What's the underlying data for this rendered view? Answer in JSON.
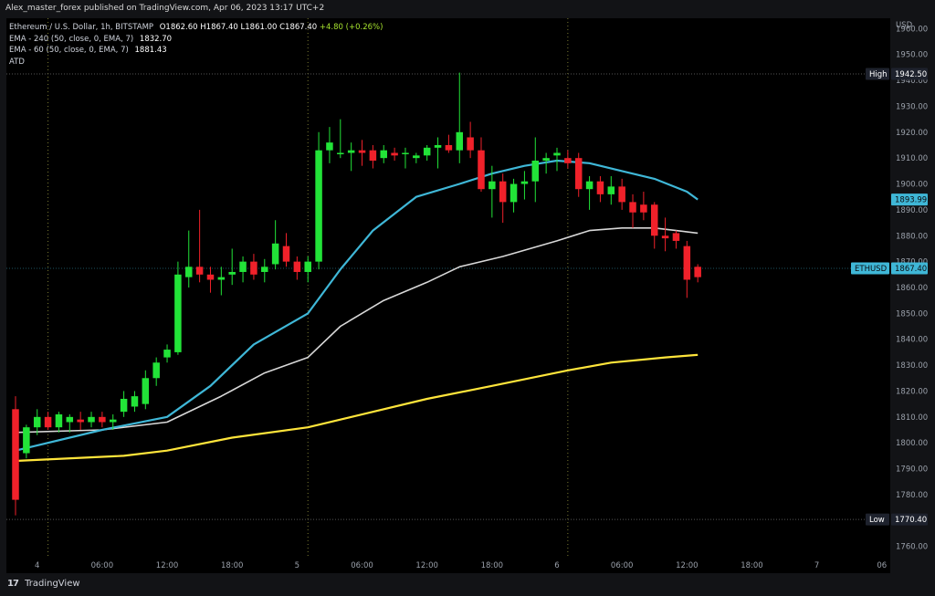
{
  "header": {
    "publisher": "Alex_master_forex published on TradingView.com, Apr 06, 2023 13:17 UTC+2"
  },
  "legend": {
    "symbol": "Ethereum / U.S. Dollar, 1h, BITSTAMP",
    "ohlc": "O1862.60  H1867.40  L1861.00  C1867.40",
    "change": "+4.80 (+0.26%)",
    "ema1_label": "EMA - 240 (50, close, 0, EMA, 7)",
    "ema1_value": "1832.70",
    "ema2_label": "EMA - 60 (50, close, 0, EMA, 7)",
    "ema2_value": "1881.43",
    "atd": "ATD"
  },
  "footer": {
    "brand": "TradingView",
    "logo": "17"
  },
  "colors": {
    "up": "#22e338",
    "down": "#f0212a",
    "ema_fast": "#3fb7d7",
    "ema_mid": "#d8d8d8",
    "ema_slow": "#ffe53b",
    "tag_blue": "#3fb7d7",
    "tag_dark": "#1e222d",
    "grid_vline": "#7a7a32",
    "hline": "#555555"
  },
  "chart_data": {
    "type": "candlestick",
    "currency": "USD",
    "y_ticks": [
      1760,
      1770,
      1780,
      1790,
      1800,
      1810,
      1820,
      1830,
      1840,
      1850,
      1860,
      1870,
      1880,
      1890,
      1900,
      1910,
      1920,
      1930,
      1940,
      1950,
      1960
    ],
    "ylim": [
      1756,
      1964
    ],
    "x_ticks": [
      {
        "label": "4",
        "bar": 2
      },
      {
        "label": "06:00",
        "bar": 8
      },
      {
        "label": "12:00",
        "bar": 14
      },
      {
        "label": "18:00",
        "bar": 20
      },
      {
        "label": "5",
        "bar": 26
      },
      {
        "label": "06:00",
        "bar": 32
      },
      {
        "label": "12:00",
        "bar": 38
      },
      {
        "label": "18:00",
        "bar": 44
      },
      {
        "label": "6",
        "bar": 50
      },
      {
        "label": "06:00",
        "bar": 56
      },
      {
        "label": "12:00",
        "bar": 62
      },
      {
        "label": "18:00",
        "bar": 68
      },
      {
        "label": "7",
        "bar": 74
      },
      {
        "label": "06",
        "bar": 80
      }
    ],
    "session_separators": [
      3,
      27,
      51
    ],
    "high": {
      "label": "High",
      "value": 1942.5
    },
    "low": {
      "label": "Low",
      "value": 1770.4
    },
    "last": {
      "label": "ETHUSD",
      "value": 1867.4
    },
    "ema_fast_tag": 1893.99,
    "ohlc": [
      [
        1813,
        1818,
        1772,
        1778
      ],
      [
        1796,
        1807,
        1794,
        1806
      ],
      [
        1806,
        1813,
        1803,
        1810
      ],
      [
        1810,
        1812,
        1805,
        1806
      ],
      [
        1806,
        1812,
        1804,
        1811
      ],
      [
        1808,
        1811,
        1804,
        1810
      ],
      [
        1809,
        1812,
        1805,
        1808
      ],
      [
        1808,
        1812,
        1806,
        1810
      ],
      [
        1810,
        1812,
        1806,
        1808
      ],
      [
        1808,
        1811,
        1805,
        1809
      ],
      [
        1812,
        1820,
        1810,
        1817
      ],
      [
        1814,
        1820,
        1812,
        1818
      ],
      [
        1815,
        1828,
        1813,
        1825
      ],
      [
        1825,
        1833,
        1822,
        1831
      ],
      [
        1833,
        1838,
        1831,
        1836
      ],
      [
        1835,
        1870,
        1834,
        1865
      ],
      [
        1864,
        1882,
        1860,
        1868
      ],
      [
        1868,
        1890,
        1862,
        1865
      ],
      [
        1865,
        1868,
        1858,
        1863
      ],
      [
        1863,
        1868,
        1857,
        1864
      ],
      [
        1865,
        1875,
        1861,
        1866
      ],
      [
        1866,
        1872,
        1862,
        1870
      ],
      [
        1870,
        1873,
        1863,
        1865
      ],
      [
        1866,
        1871,
        1862,
        1868
      ],
      [
        1869,
        1886,
        1867,
        1877
      ],
      [
        1876,
        1881,
        1868,
        1870
      ],
      [
        1870,
        1872,
        1863,
        1866
      ],
      [
        1866,
        1872,
        1862,
        1870
      ],
      [
        1870,
        1920,
        1867,
        1913
      ],
      [
        1913,
        1922,
        1908,
        1916
      ],
      [
        1912,
        1925,
        1910,
        1912
      ],
      [
        1912,
        1916,
        1905,
        1913
      ],
      [
        1913,
        1917,
        1907,
        1912
      ],
      [
        1913,
        1915,
        1906,
        1909
      ],
      [
        1910,
        1915,
        1908,
        1913
      ],
      [
        1912,
        1914,
        1909,
        1911
      ],
      [
        1912,
        1914,
        1906,
        1912
      ],
      [
        1910,
        1912,
        1908,
        1911
      ],
      [
        1911,
        1915,
        1909,
        1914
      ],
      [
        1914,
        1918,
        1906,
        1915
      ],
      [
        1915,
        1919,
        1912,
        1913
      ],
      [
        1913,
        1943,
        1908,
        1920
      ],
      [
        1918,
        1924,
        1910,
        1913
      ],
      [
        1913,
        1918,
        1897,
        1898
      ],
      [
        1898,
        1907,
        1887,
        1901
      ],
      [
        1901,
        1904,
        1885,
        1893
      ],
      [
        1893,
        1902,
        1889,
        1900
      ],
      [
        1900,
        1905,
        1894,
        1901
      ],
      [
        1901,
        1918,
        1893,
        1909
      ],
      [
        1909,
        1912,
        1904,
        1910
      ],
      [
        1911,
        1914,
        1905,
        1912
      ],
      [
        1910,
        1913,
        1906,
        1908
      ],
      [
        1910,
        1912,
        1895,
        1898
      ],
      [
        1898,
        1903,
        1890,
        1901
      ],
      [
        1901,
        1903,
        1893,
        1896
      ],
      [
        1896,
        1903,
        1892,
        1899
      ],
      [
        1899,
        1902,
        1890,
        1893
      ],
      [
        1893,
        1896,
        1883,
        1889
      ],
      [
        1892,
        1897,
        1886,
        1889
      ],
      [
        1892,
        1893,
        1875,
        1880
      ],
      [
        1880,
        1887,
        1874,
        1879
      ],
      [
        1881,
        1882,
        1875,
        1878
      ],
      [
        1876,
        1878,
        1856,
        1863
      ],
      [
        1868,
        1869,
        1862,
        1864
      ]
    ],
    "ema_fast": [
      [
        0,
        1797
      ],
      [
        8,
        1805
      ],
      [
        14,
        1810
      ],
      [
        18,
        1822
      ],
      [
        22,
        1838
      ],
      [
        27,
        1850
      ],
      [
        30,
        1867
      ],
      [
        33,
        1882
      ],
      [
        37,
        1895
      ],
      [
        41,
        1900
      ],
      [
        44,
        1904
      ],
      [
        47,
        1907
      ],
      [
        50,
        1909
      ],
      [
        53,
        1908
      ],
      [
        56,
        1905
      ],
      [
        59,
        1902
      ],
      [
        62,
        1897
      ],
      [
        63,
        1894
      ]
    ],
    "ema_mid": [
      [
        0,
        1804
      ],
      [
        8,
        1805
      ],
      [
        14,
        1808
      ],
      [
        19,
        1818
      ],
      [
        23,
        1827
      ],
      [
        27,
        1833
      ],
      [
        30,
        1845
      ],
      [
        34,
        1855
      ],
      [
        38,
        1862
      ],
      [
        41,
        1868
      ],
      [
        45,
        1872
      ],
      [
        50,
        1878
      ],
      [
        53,
        1882
      ],
      [
        56,
        1883
      ],
      [
        59,
        1883
      ],
      [
        61,
        1882
      ],
      [
        63,
        1881
      ]
    ],
    "ema_slow": [
      [
        0,
        1793
      ],
      [
        10,
        1795
      ],
      [
        14,
        1797
      ],
      [
        20,
        1802
      ],
      [
        27,
        1806
      ],
      [
        33,
        1812
      ],
      [
        38,
        1817
      ],
      [
        44,
        1822
      ],
      [
        51,
        1828
      ],
      [
        55,
        1831
      ],
      [
        60,
        1833
      ],
      [
        63,
        1834
      ]
    ]
  }
}
